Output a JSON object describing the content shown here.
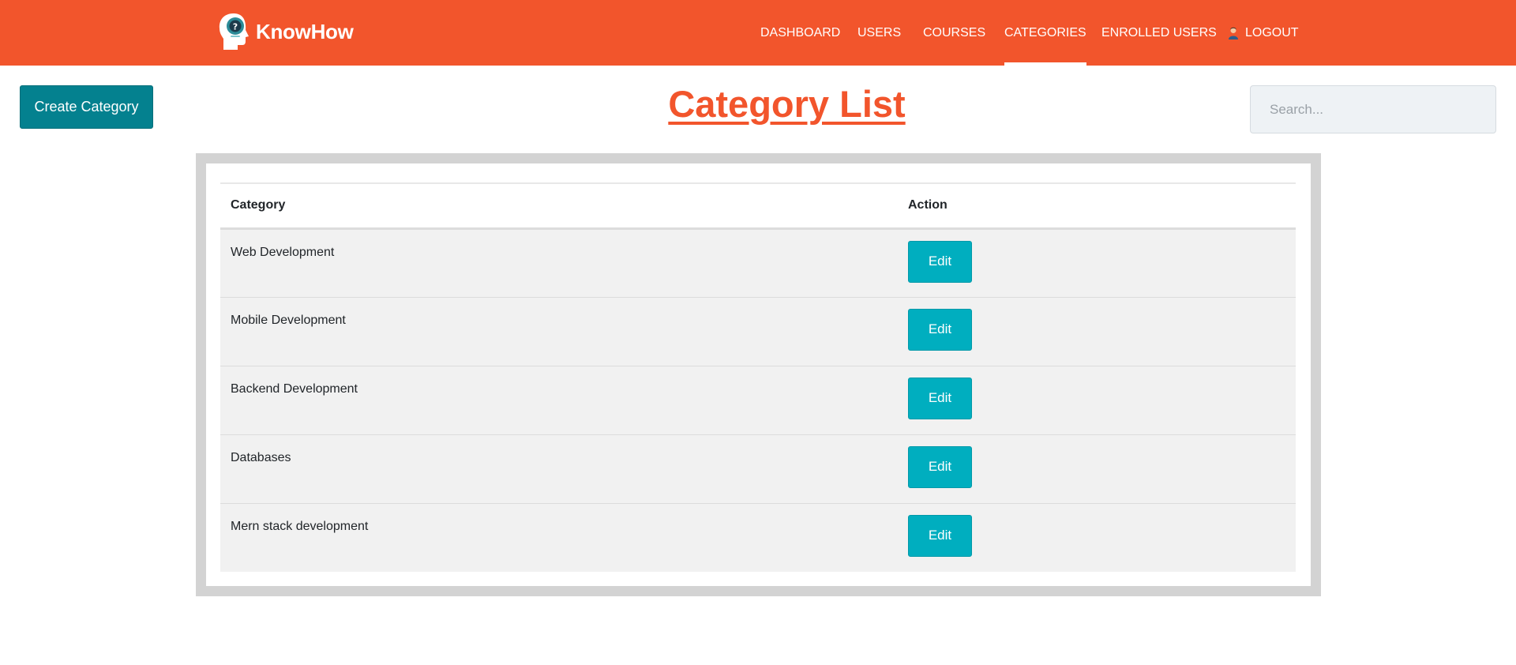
{
  "brand": {
    "name": "KnowHow",
    "logo_icon": "head-question-logo-icon"
  },
  "nav": {
    "items": [
      {
        "label": "DASHBOARD"
      },
      {
        "label": "USERS"
      },
      {
        "label": "COURSES"
      },
      {
        "label": "CATEGORIES",
        "active": true
      },
      {
        "label": "ENROLLED USERS"
      }
    ],
    "logout_label": "LOGOUT"
  },
  "toolbar": {
    "create_label": "Create Category"
  },
  "page": {
    "title": "Category List"
  },
  "search": {
    "placeholder": "Search...",
    "value": ""
  },
  "table": {
    "headers": {
      "category": "Category",
      "action": "Action"
    },
    "rows": [
      {
        "category": "Web Development",
        "action_label": "Edit"
      },
      {
        "category": "Mobile Development",
        "action_label": "Edit"
      },
      {
        "category": "Backend Development",
        "action_label": "Edit"
      },
      {
        "category": "Databases",
        "action_label": "Edit"
      },
      {
        "category": "Mern stack development",
        "action_label": "Edit"
      }
    ]
  },
  "colors": {
    "navbar": "#f2552c",
    "title": "#f2552c",
    "create_button": "#04818f",
    "edit_button": "#00aebf",
    "frame": "#d3d3d3",
    "row_background": "#f1f1f1"
  }
}
